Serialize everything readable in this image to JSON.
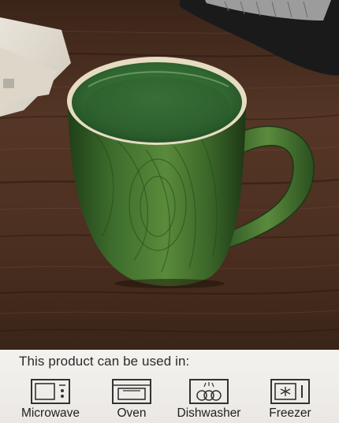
{
  "panel": {
    "title": "This product can be used in:"
  },
  "features": [
    {
      "label": "Microwave",
      "icon": "microwave-icon"
    },
    {
      "label": "Oven",
      "icon": "oven-icon"
    },
    {
      "label": "Dishwasher",
      "icon": "dishwasher-icon"
    },
    {
      "label": "Freezer",
      "icon": "freezer-icon"
    }
  ],
  "colors": {
    "mug_green": "#3f6e2e",
    "mug_rim": "#e8dcc0",
    "wood": "#4a2f1f",
    "panel_bg": "#f2f0ed"
  }
}
